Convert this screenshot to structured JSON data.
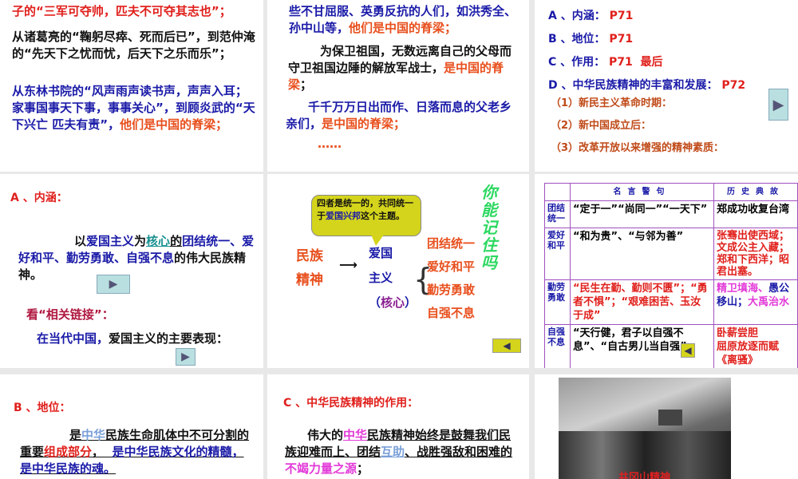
{
  "p1": {
    "l1": "子的“三军可夺帅，匹夫不可夺其志也”；",
    "l2": "从诸葛亮的“鞠躬尽瘁、死而后已”，到范仲淹的“先天下之忧而忧，后天下之乐而乐”；",
    "l3a": "从东林书院的“风声雨声读书声，声声入耳；家事国事天下事，事事关心”，到顾炎武的“天下兴亡 匹夫有责”，",
    "l3b": "他们是中国的脊梁；"
  },
  "p2": {
    "l1a": "些不甘屈服、英勇反抗的人们，如洪秀全、孙中山等，",
    "l1b": "他们是中国的脊梁；",
    "l2a": "为保卫祖国，无数远离自己的父母而守卫祖国边陲的解放军战士，",
    "l2b": "是中国的脊梁",
    "l2c": "；",
    "l3a": "千千万万日出而作、日落而息的父老乡亲们，",
    "l3b": "是中国的脊梁；",
    "l4": "……"
  },
  "p3": {
    "items": [
      {
        "label": "A 、内涵：",
        "page": "P71",
        "extra": ""
      },
      {
        "label": "B 、地位：",
        "page": "P71",
        "extra": ""
      },
      {
        "label": "C 、作用：",
        "page": "P71",
        "extra": "最后"
      },
      {
        "label": "D 、中华民族精神的丰富和发展：",
        "page": "P72",
        "extra": ""
      }
    ],
    "subs": [
      "（1）新民主义革命时期：",
      "（2）新中国成立后：",
      "（3）改革开放以来增强的精神素质："
    ],
    "nav": "▶"
  },
  "p4": {
    "title": "A 、内涵：",
    "t1": "以",
    "t2": "爱国主义",
    "t3": "为",
    "t4": "核心",
    "t5": "的",
    "t6": "团结统一、爱好和平、勤劳勇敢、自强不息",
    "t7": "的伟大民族精神。",
    "link": "看“相关链接”：",
    "q1": "在当代中国，",
    "q2": "爱国主义的主要表现：",
    "nav": "▶"
  },
  "p5": {
    "bubble1": "四者是统一的，共同统一于",
    "bubble2": "爱国兴邦",
    "bubble3": "这个主题。",
    "left1": "民族",
    "left2": "精神",
    "arrow": "⟶",
    "mid1": "爱国",
    "mid2": "主义",
    "mid3a": "（",
    "mid3b": "核心",
    "mid3c": "）",
    "right": [
      "团结统一",
      "爱好和平",
      "勤劳勇敢",
      "自强不息"
    ],
    "art": "你能记住吗",
    "nav": "◀"
  },
  "p6": {
    "headers": [
      "名言警句",
      "历史典故"
    ],
    "rows": [
      {
        "k": "团结统一",
        "q": "“定于一”“尚同一”“一天下”",
        "h": "郑成功收复台湾"
      },
      {
        "k": "爱好和平",
        "q": "“和为贵”、“与邻为善”",
        "h": "张骞出使西域；文成公主入藏；郑和下西洋；昭君出塞。"
      },
      {
        "k": "勤劳勇敢",
        "q": "“民生在勤、勤则不匮”；“勇者不惧”；“艰难困苦、玉汝于成”",
        "h1": "精卫填海、",
        "h2": "愚公移山；",
        "h3": "大禹治水"
      },
      {
        "k": "自强不息",
        "q": "“天行健，君子以自强不息”、“自古男儿当自强”",
        "h": "卧薪尝胆",
        "h4": "屈原放逐而赋《离骚》"
      }
    ],
    "nav": "◀"
  },
  "p7": {
    "title": "B 、地位：",
    "a": "是",
    "b": "中华",
    "c": "民族生命肌体中不可分割的重要",
    "d": "组成部分",
    "e": "，",
    "f": "是中华民族文化的精髓，是中华民族的魂。"
  },
  "p8": {
    "title": "C 、中华民族精神的作用：",
    "a": "伟大的",
    "b": "中华",
    "c": "民族精神始终是鼓舞我们民族迎难而上、团结",
    "d": "互助",
    "e": "、战胜强敌和困难的",
    "f": "不竭力量之源",
    "g": "；"
  },
  "p9": {
    "caption": "井冈山精神"
  }
}
